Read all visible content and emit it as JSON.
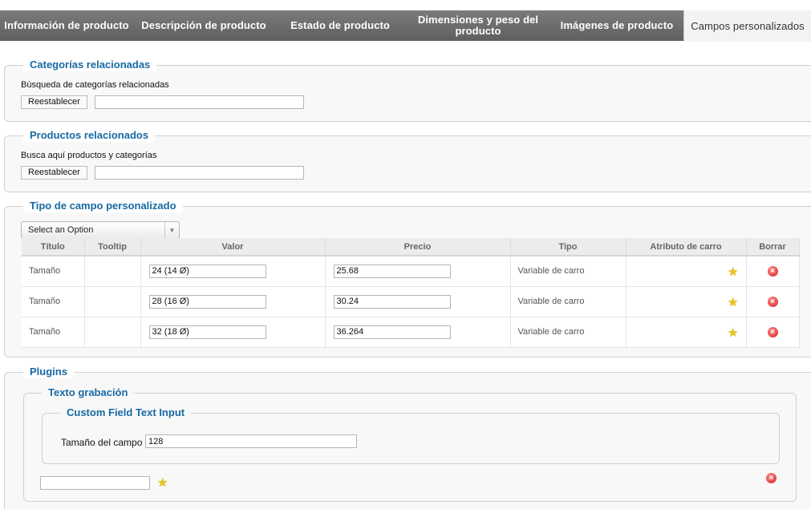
{
  "tabs": [
    {
      "label": "Información de producto"
    },
    {
      "label": "Descripción de producto"
    },
    {
      "label": "Estado de producto"
    },
    {
      "label": "Dimensiones y peso del producto"
    },
    {
      "label": "Imágenes de producto"
    },
    {
      "label": "Campos personalizados"
    }
  ],
  "categorias": {
    "legend": "Categorías relacionadas",
    "label": "Búsqueda de categorías relacionadas",
    "reset_label": "Reestablecer",
    "search_value": ""
  },
  "productos": {
    "legend": "Productos relacionados",
    "label": "Busca aquí productos y categorías",
    "reset_label": "Reestablecer",
    "search_value": ""
  },
  "tipo": {
    "legend": "Tipo de campo personalizado",
    "select_value": "Select an Option",
    "columns": [
      "Título",
      "Tooltip",
      "Valor",
      "Precio",
      "Tipo",
      "Atributo de carro",
      "Borrar"
    ],
    "rows": [
      {
        "titulo": "Tamaño",
        "tooltip": "",
        "valor": "24 (14 Ø)",
        "precio": "25.68",
        "tipo": "Variable de carro"
      },
      {
        "titulo": "Tamaño",
        "tooltip": "",
        "valor": "28 (16 Ø)",
        "precio": "30.24",
        "tipo": "Variable de carro"
      },
      {
        "titulo": "Tamaño",
        "tooltip": "",
        "valor": "32 (18 Ø)",
        "precio": "36.264",
        "tipo": "Variable de carro"
      }
    ]
  },
  "plugins": {
    "legend": "Plugins",
    "texto_legend": "Texto grabación",
    "custom_legend": "Custom Field Text Input",
    "size_label": "Tamaño del campo",
    "size_value": "128",
    "extra_value": ""
  },
  "icons": {
    "star": "star-icon",
    "delete": "delete-icon"
  },
  "colors": {
    "legend": "#176aa3",
    "tabbar": "#6a6a6a",
    "star": "#e8c51d",
    "delete": "#d42020"
  }
}
